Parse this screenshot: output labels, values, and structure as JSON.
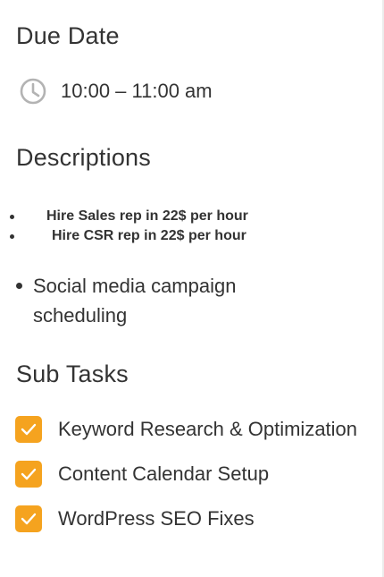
{
  "due_date": {
    "title": "Due Date",
    "time": "10:00 – 11:00 am",
    "icon": "clock-icon"
  },
  "descriptions": {
    "title": "Descriptions",
    "bullets": [
      "Hire Sales rep in 22$ per hour",
      "Hire CSR rep in 22$ per hour",
      "Social media campaign scheduling"
    ]
  },
  "sub_tasks": {
    "title": "Sub Tasks",
    "items": [
      {
        "label": "Keyword Research & Optimization",
        "checked": true
      },
      {
        "label": "Content Calendar Setup",
        "checked": true
      },
      {
        "label": "WordPress SEO Fixes",
        "checked": true
      }
    ]
  },
  "colors": {
    "accent": "#f5a31f",
    "text": "#333333",
    "icon_gray": "#b3b3b3"
  }
}
